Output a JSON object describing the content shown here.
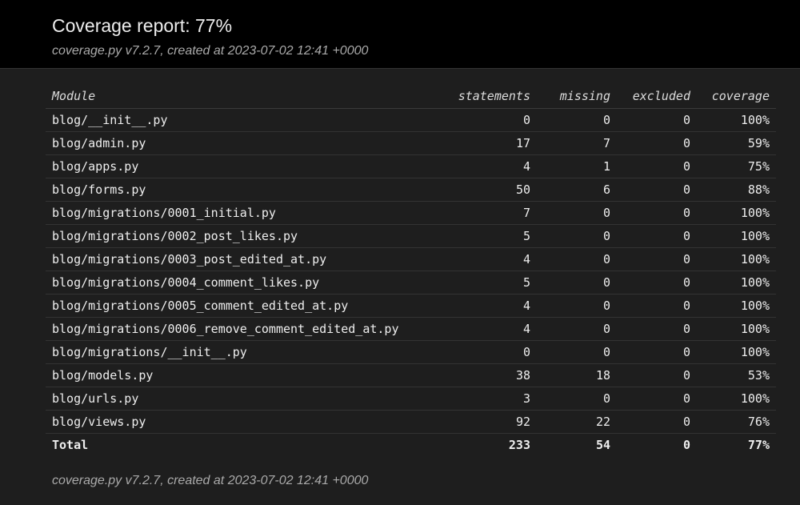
{
  "header": {
    "title": "Coverage report: 77%",
    "meta": "coverage.py v7.2.7, created at 2023-07-02 12:41 +0000"
  },
  "table": {
    "columns": [
      "Module",
      "statements",
      "missing",
      "excluded",
      "coverage"
    ],
    "rows": [
      {
        "module": "blog/__init__.py",
        "statements": "0",
        "missing": "0",
        "excluded": "0",
        "coverage": "100%"
      },
      {
        "module": "blog/admin.py",
        "statements": "17",
        "missing": "7",
        "excluded": "0",
        "coverage": "59%"
      },
      {
        "module": "blog/apps.py",
        "statements": "4",
        "missing": "1",
        "excluded": "0",
        "coverage": "75%"
      },
      {
        "module": "blog/forms.py",
        "statements": "50",
        "missing": "6",
        "excluded": "0",
        "coverage": "88%"
      },
      {
        "module": "blog/migrations/0001_initial.py",
        "statements": "7",
        "missing": "0",
        "excluded": "0",
        "coverage": "100%"
      },
      {
        "module": "blog/migrations/0002_post_likes.py",
        "statements": "5",
        "missing": "0",
        "excluded": "0",
        "coverage": "100%"
      },
      {
        "module": "blog/migrations/0003_post_edited_at.py",
        "statements": "4",
        "missing": "0",
        "excluded": "0",
        "coverage": "100%"
      },
      {
        "module": "blog/migrations/0004_comment_likes.py",
        "statements": "5",
        "missing": "0",
        "excluded": "0",
        "coverage": "100%"
      },
      {
        "module": "blog/migrations/0005_comment_edited_at.py",
        "statements": "4",
        "missing": "0",
        "excluded": "0",
        "coverage": "100%"
      },
      {
        "module": "blog/migrations/0006_remove_comment_edited_at.py",
        "statements": "4",
        "missing": "0",
        "excluded": "0",
        "coverage": "100%"
      },
      {
        "module": "blog/migrations/__init__.py",
        "statements": "0",
        "missing": "0",
        "excluded": "0",
        "coverage": "100%"
      },
      {
        "module": "blog/models.py",
        "statements": "38",
        "missing": "18",
        "excluded": "0",
        "coverage": "53%"
      },
      {
        "module": "blog/urls.py",
        "statements": "3",
        "missing": "0",
        "excluded": "0",
        "coverage": "100%"
      },
      {
        "module": "blog/views.py",
        "statements": "92",
        "missing": "22",
        "excluded": "0",
        "coverage": "76%"
      }
    ],
    "total": {
      "module": "Total",
      "statements": "233",
      "missing": "54",
      "excluded": "0",
      "coverage": "77%"
    }
  },
  "footer": {
    "meta": "coverage.py v7.2.7, created at 2023-07-02 12:41 +0000"
  },
  "colors": {
    "header_bg": "#000000",
    "page_bg": "#1e1e1e",
    "text": "#eeeeee",
    "muted": "#aaaaaa"
  }
}
